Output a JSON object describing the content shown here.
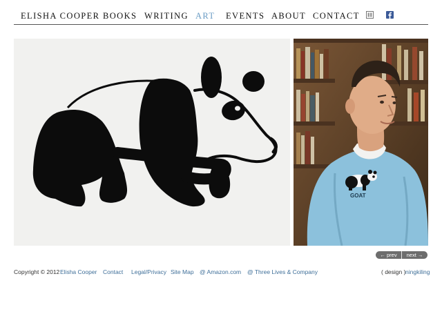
{
  "nav": {
    "brand": "ELISHA COOPER",
    "items": [
      {
        "label": "BOOKS"
      },
      {
        "label": "WRITING"
      },
      {
        "label": "ART"
      },
      {
        "label": "EVENTS"
      },
      {
        "label": "ABOUT"
      },
      {
        "label": "CONTACT"
      }
    ],
    "active_color": "#6a9cc4",
    "icons": [
      "mail-icon",
      "facebook-icon"
    ]
  },
  "gallery": {
    "shirt_text": "GOAT"
  },
  "pager": {
    "prev_label": "← prev",
    "next_label": "next →"
  },
  "footer": {
    "copyright_prefix": "Copyright © 2012",
    "copyright_name": "Elisha Cooper",
    "links": [
      "Contact",
      "Legal/Privacy",
      "Site Map",
      "@ Amazon.com",
      "@ Three Lives & Company"
    ],
    "design_label": "( design )",
    "designer": "ningkiling",
    "link_color": "#3f6f99"
  }
}
